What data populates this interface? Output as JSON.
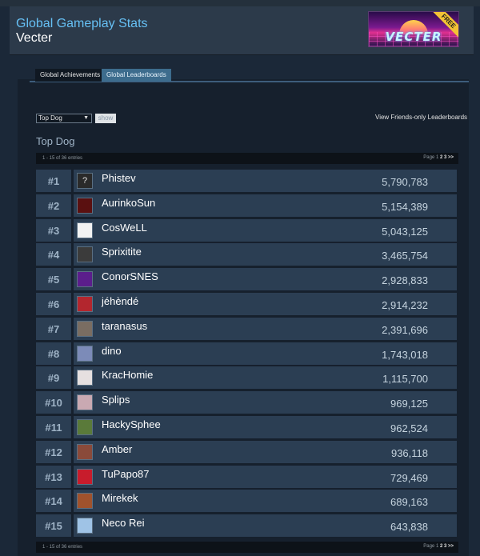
{
  "header": {
    "title": "Global Gameplay Stats",
    "game": "Vecter",
    "logo_text": "VECTER",
    "logo_badge": "FREE"
  },
  "tabs": [
    {
      "label": "Global Achievements",
      "active": false
    },
    {
      "label": "Global Leaderboards",
      "active": true
    }
  ],
  "controls": {
    "select_value": "Top Dog",
    "show_label": "show",
    "friends_link": "View Friends-only Leaderboards"
  },
  "leaderboard": {
    "title": "Top Dog",
    "entries_info": "1 - 15 of 36 entries",
    "page_label": "Page",
    "pages": [
      "1",
      "2",
      "3",
      ">>"
    ],
    "current_page": "1",
    "rows": [
      {
        "rank": "#1",
        "name": "Phistev",
        "score": "5,790,783",
        "avatar_color": "#2a2a2a",
        "avatar_icon": "question-mark"
      },
      {
        "rank": "#2",
        "name": "AurinkoSun",
        "score": "5,154,389",
        "avatar_color": "#5a1010",
        "avatar_icon": "avatar"
      },
      {
        "rank": "#3",
        "name": "CosWeLL",
        "score": "5,043,125",
        "avatar_color": "#f2f2f2",
        "avatar_icon": "avatar"
      },
      {
        "rank": "#4",
        "name": "Sprixitite",
        "score": "3,465,754",
        "avatar_color": "#3b3b3b",
        "avatar_icon": "avatar"
      },
      {
        "rank": "#5",
        "name": "ConorSNES",
        "score": "2,928,833",
        "avatar_color": "#5b1e8c",
        "avatar_icon": "avatar"
      },
      {
        "rank": "#6",
        "name": "jéhèndé",
        "score": "2,914,232",
        "avatar_color": "#b3262e",
        "avatar_icon": "avatar"
      },
      {
        "rank": "#7",
        "name": "taranasus",
        "score": "2,391,696",
        "avatar_color": "#7a6d62",
        "avatar_icon": "avatar"
      },
      {
        "rank": "#8",
        "name": "dino",
        "score": "1,743,018",
        "avatar_color": "#7c8bb8",
        "avatar_icon": "avatar"
      },
      {
        "rank": "#9",
        "name": "KracHomie",
        "score": "1,115,700",
        "avatar_color": "#e6e0e0",
        "avatar_icon": "avatar"
      },
      {
        "rank": "#10",
        "name": "Splips",
        "score": "969,125",
        "avatar_color": "#c9a9b2",
        "avatar_icon": "avatar"
      },
      {
        "rank": "#11",
        "name": "HackySphee",
        "score": "962,524",
        "avatar_color": "#5a7a3a",
        "avatar_icon": "avatar"
      },
      {
        "rank": "#12",
        "name": "Amber",
        "score": "936,118",
        "avatar_color": "#8a4a3a",
        "avatar_icon": "avatar"
      },
      {
        "rank": "#13",
        "name": "TuPapo87",
        "score": "729,469",
        "avatar_color": "#c81c2c",
        "avatar_icon": "avatar"
      },
      {
        "rank": "#14",
        "name": "Mirekek",
        "score": "689,163",
        "avatar_color": "#a0522d",
        "avatar_icon": "avatar"
      },
      {
        "rank": "#15",
        "name": "Neco Rei",
        "score": "643,838",
        "avatar_color": "#9fc3e6",
        "avatar_icon": "avatar"
      }
    ]
  },
  "colors": {
    "background": "#1b2838",
    "accent": "#66c0f4",
    "row": "#2b3e53",
    "active_tab": "#3d6c8d"
  }
}
